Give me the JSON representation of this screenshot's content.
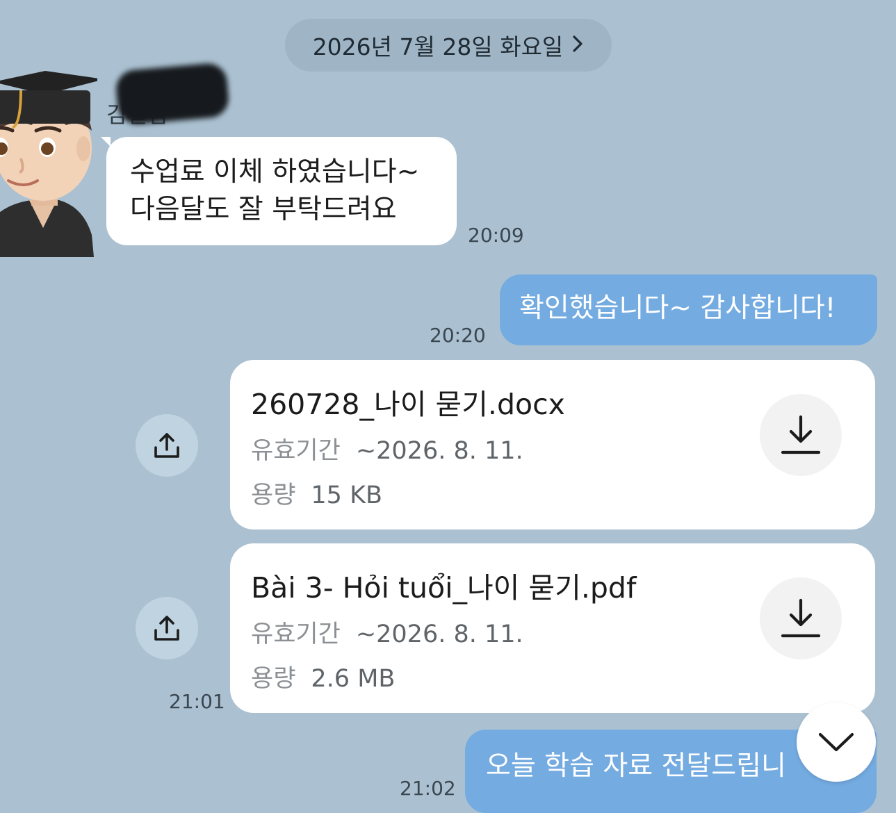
{
  "date_header": {
    "label": "2026년 7월 28일 화요일",
    "chevron_icon": "chevron-right-icon"
  },
  "messages": [
    {
      "sender": "김일범",
      "direction": "incoming",
      "lines": [
        "수업료 이체 하였습니다~",
        "다음달도 잘 부탁드려요"
      ],
      "time": "20:09"
    },
    {
      "direction": "outgoing",
      "text": "확인했습니다~ 감사합니다!",
      "time": "20:20"
    }
  ],
  "files": [
    {
      "name": "260728_나이 묻기.docx",
      "expiry_label": "유효기간",
      "expiry_value": "~2026. 8. 11.",
      "size_label": "용량",
      "size_value": "15 KB"
    },
    {
      "name": "Bài 3- Hỏi tuổi_나이 묻기.pdf",
      "expiry_label": "유효기간",
      "expiry_value": "~2026. 8. 11.",
      "size_label": "용량",
      "size_value": "2.6 MB"
    }
  ],
  "files_time": "21:01",
  "last_message": {
    "text": "오늘 학습 자료 전달드립니",
    "time": "21:02"
  },
  "colors": {
    "background": "#abc1d1",
    "outgoing_bubble": "#74abe1",
    "incoming_bubble": "#ffffff"
  }
}
